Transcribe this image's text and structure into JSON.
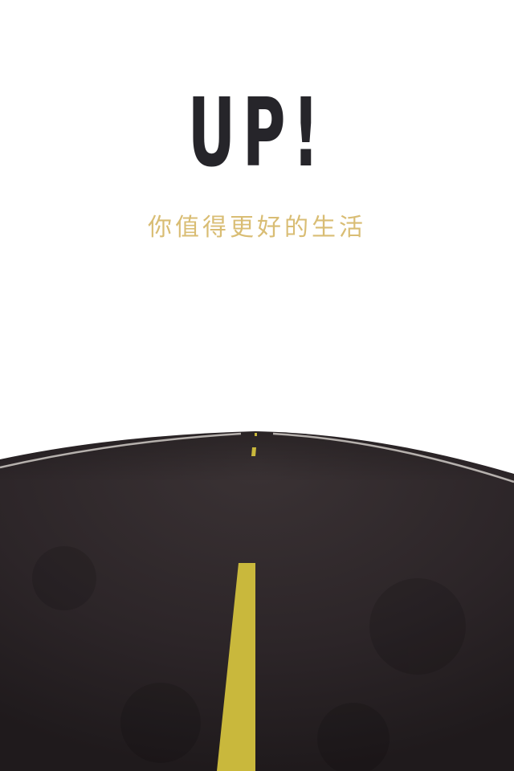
{
  "splash": {
    "logo": "UP!",
    "tagline": "你值得更好的生活"
  },
  "colors": {
    "background": "#ffffff",
    "logo": "#26252a",
    "tagline": "#d9bd74",
    "asphalt": "#2b2527",
    "center_line": "#c9b83c"
  }
}
